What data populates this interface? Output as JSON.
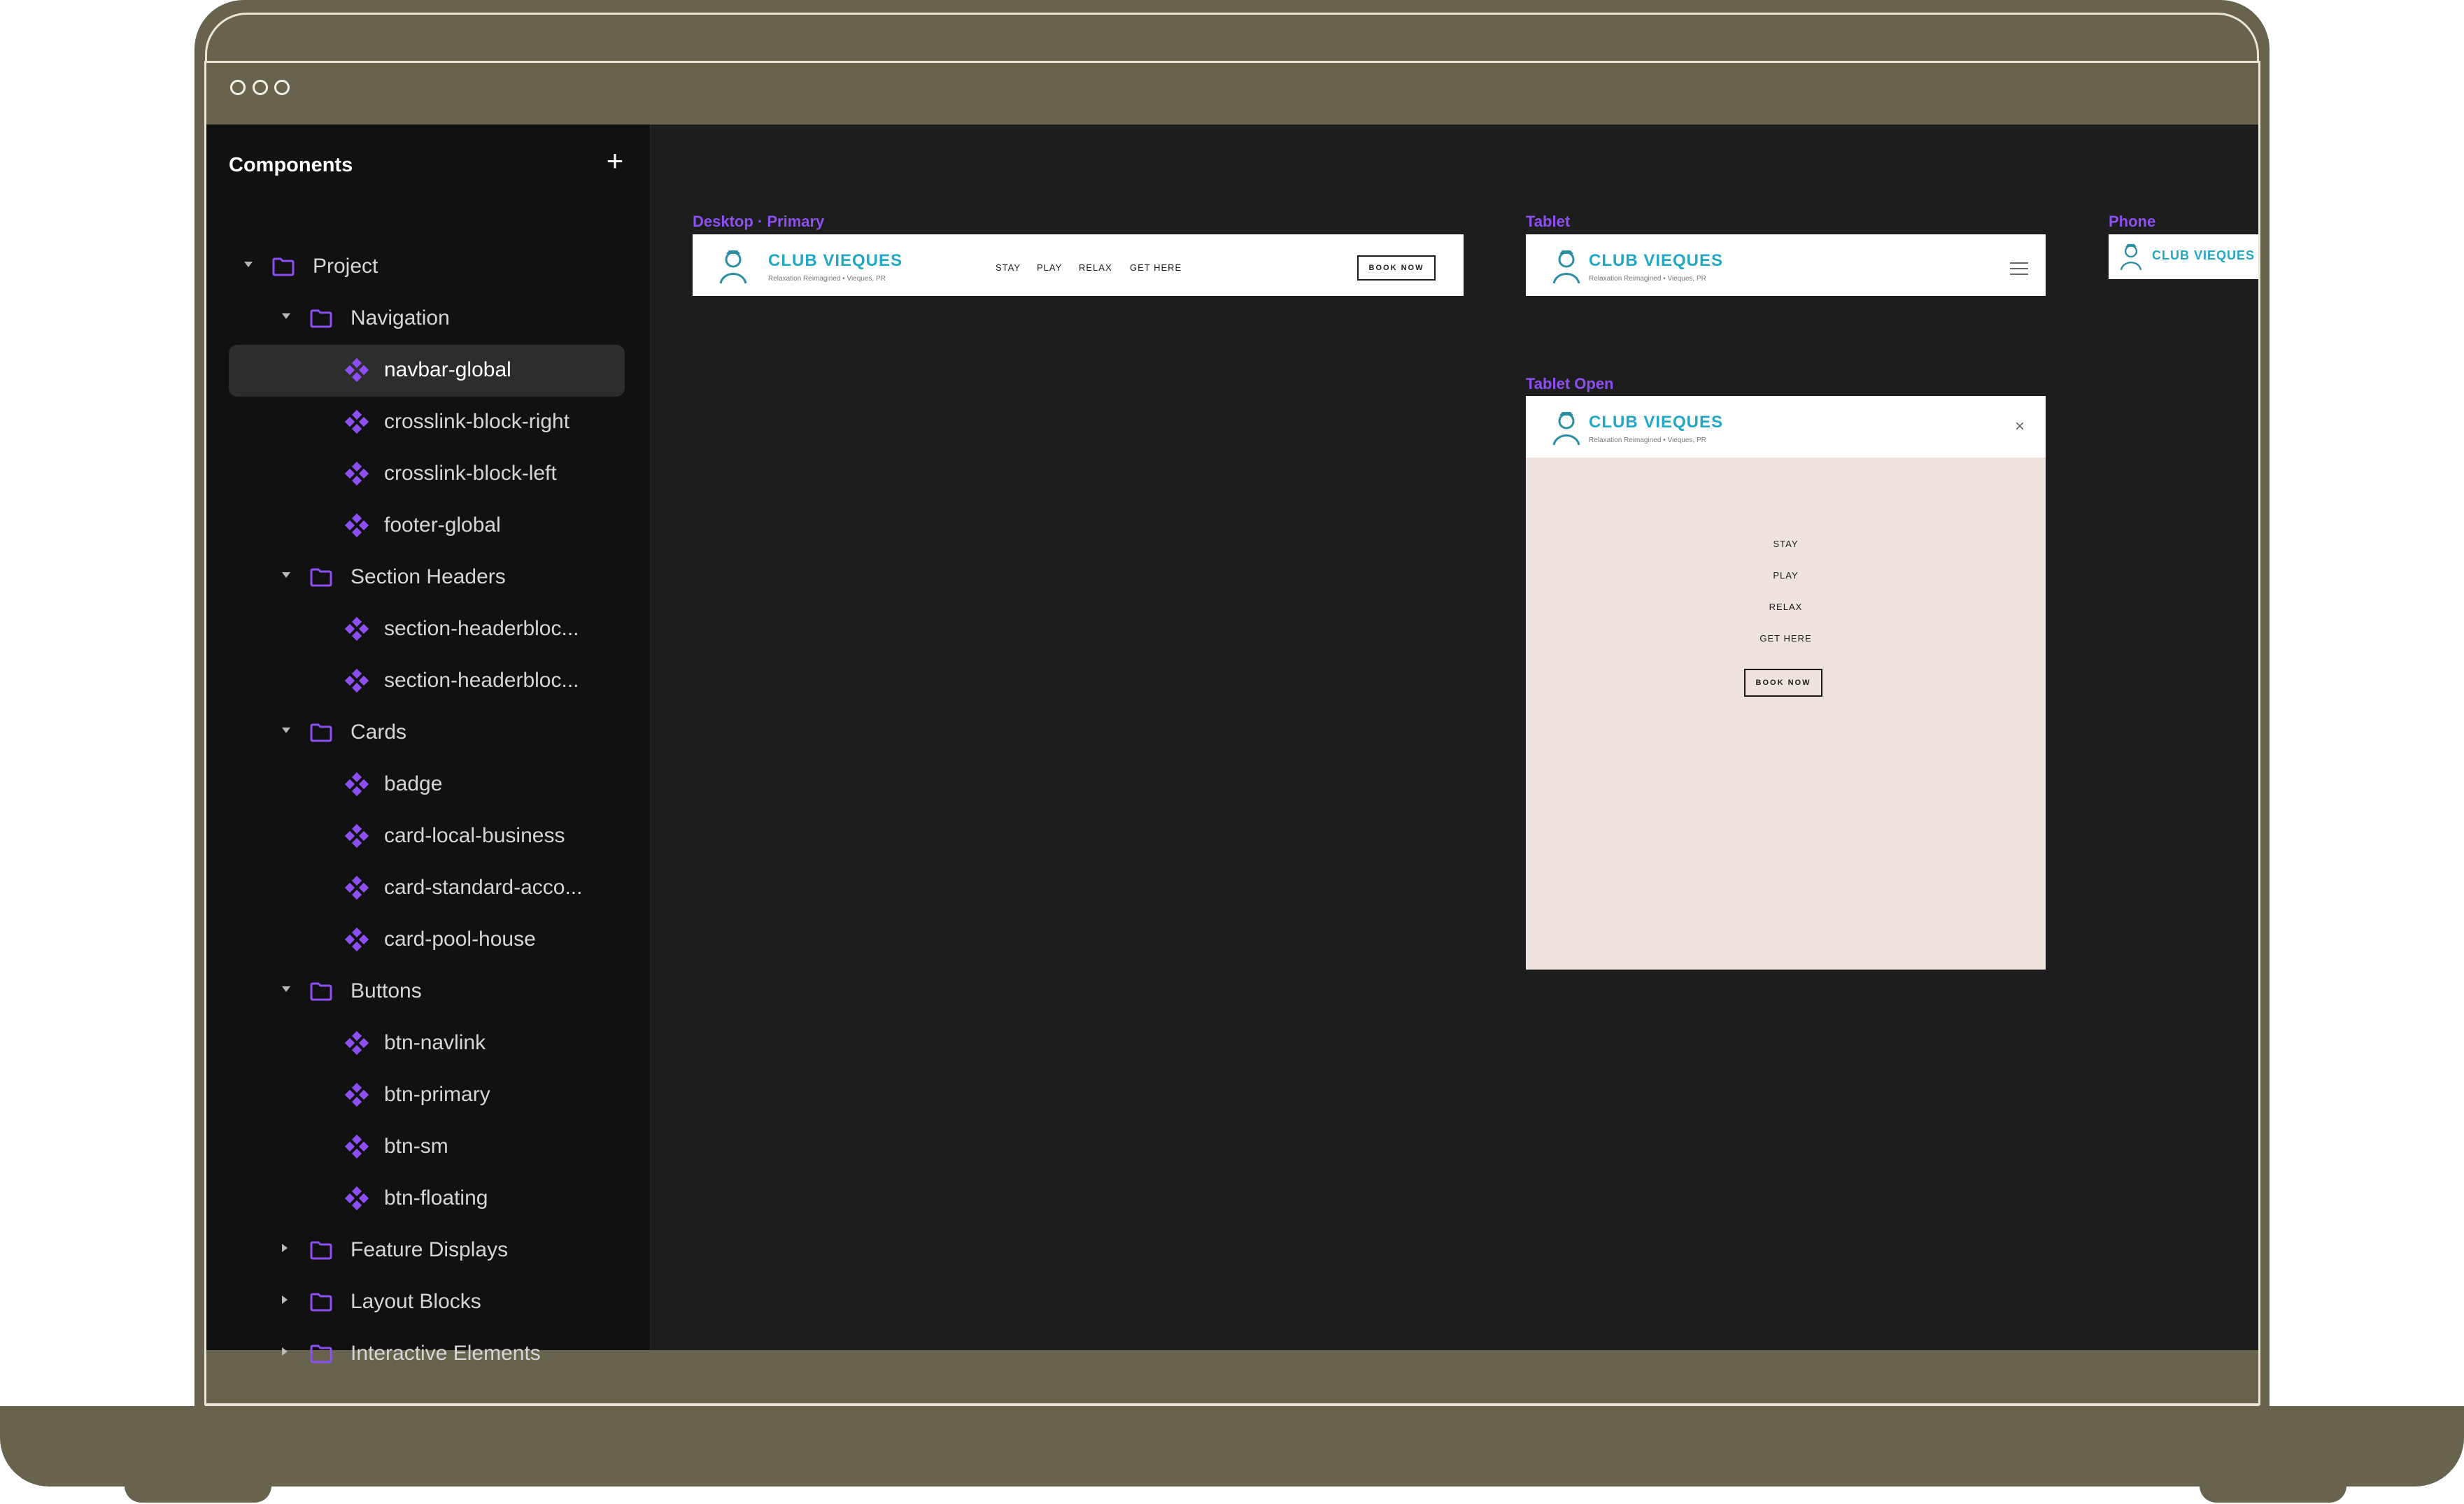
{
  "sidebar": {
    "title": "Components",
    "add_label": "+",
    "items": [
      {
        "label": "Project",
        "type": "folder",
        "state": "expanded"
      },
      {
        "label": "Navigation",
        "type": "folder",
        "state": "expanded"
      },
      {
        "label": "navbar-global",
        "type": "component",
        "selected": true
      },
      {
        "label": "crosslink-block-right",
        "type": "component"
      },
      {
        "label": "crosslink-block-left",
        "type": "component"
      },
      {
        "label": "footer-global",
        "type": "component"
      },
      {
        "label": "Section Headers",
        "type": "folder",
        "state": "expanded"
      },
      {
        "label": "section-headerbloc...",
        "type": "component"
      },
      {
        "label": "section-headerbloc...",
        "type": "component"
      },
      {
        "label": "Cards",
        "type": "folder",
        "state": "expanded"
      },
      {
        "label": "badge",
        "type": "component"
      },
      {
        "label": "card-local-business",
        "type": "component"
      },
      {
        "label": "card-standard-acco...",
        "type": "component"
      },
      {
        "label": "card-pool-house",
        "type": "component"
      },
      {
        "label": "Buttons",
        "type": "folder",
        "state": "expanded"
      },
      {
        "label": "btn-navlink",
        "type": "component"
      },
      {
        "label": "btn-primary",
        "type": "component"
      },
      {
        "label": "btn-sm",
        "type": "component"
      },
      {
        "label": "btn-floating",
        "type": "component"
      },
      {
        "label": "Feature Displays",
        "type": "folder",
        "state": "collapsed"
      },
      {
        "label": "Layout Blocks",
        "type": "folder",
        "state": "collapsed"
      },
      {
        "label": "Interactive Elements",
        "type": "folder",
        "state": "collapsed"
      }
    ]
  },
  "canvas": {
    "desktop": {
      "label": "Desktop · Primary",
      "brand": "CLUB VIEQUES",
      "tagline": "Relaxation Reimagined • Vieques, PR",
      "links": [
        "STAY",
        "PLAY",
        "RELAX",
        "GET HERE"
      ],
      "cta": "BOOK NOW"
    },
    "tablet": {
      "label": "Tablet",
      "brand": "CLUB VIEQUES",
      "tagline": "Relaxation Reimagined • Vieques, PR"
    },
    "tablet_open": {
      "label": "Tablet Open",
      "brand": "CLUB VIEQUES",
      "tagline": "Relaxation Reimagined • Vieques, PR",
      "close": "×",
      "links": [
        "STAY",
        "PLAY",
        "RELAX",
        "GET HERE"
      ],
      "cta": "BOOK NOW"
    },
    "phone": {
      "label": "Phone",
      "brand": "CLUB VIEQUES"
    }
  },
  "colors": {
    "accent": "#8d4ff3",
    "brand": "#22a7c4",
    "menu_panel": "#efe3dd",
    "laptop": "#67634d"
  }
}
